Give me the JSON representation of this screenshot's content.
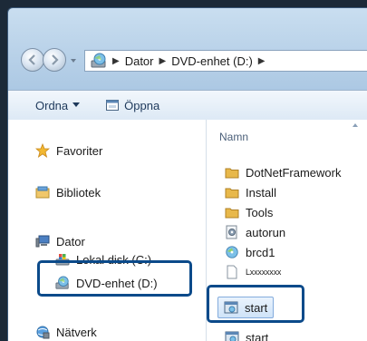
{
  "address": {
    "crumbs": [
      "Dator",
      "DVD-enhet (D:)"
    ]
  },
  "toolbar": {
    "organize_label": "Ordna",
    "open_label": "Öppna"
  },
  "navigation": {
    "favorites": "Favoriter",
    "libraries": "Bibliotek",
    "computer": "Dator",
    "local_disk": "Lokal disk (C:)",
    "dvd_drive": "DVD-enhet (D:)",
    "network": "Nätverk"
  },
  "files": {
    "column_name": "Namn",
    "items": [
      "DotNetFramework",
      "Install",
      "Tools",
      "autorun",
      "brcd1",
      "Lxxxxxxxx",
      "start",
      "start"
    ],
    "selected": "start"
  },
  "colors": {
    "highlight_border": "#0b4a8a",
    "folder": "#e8b84a",
    "selection": "#cfe3f8"
  }
}
